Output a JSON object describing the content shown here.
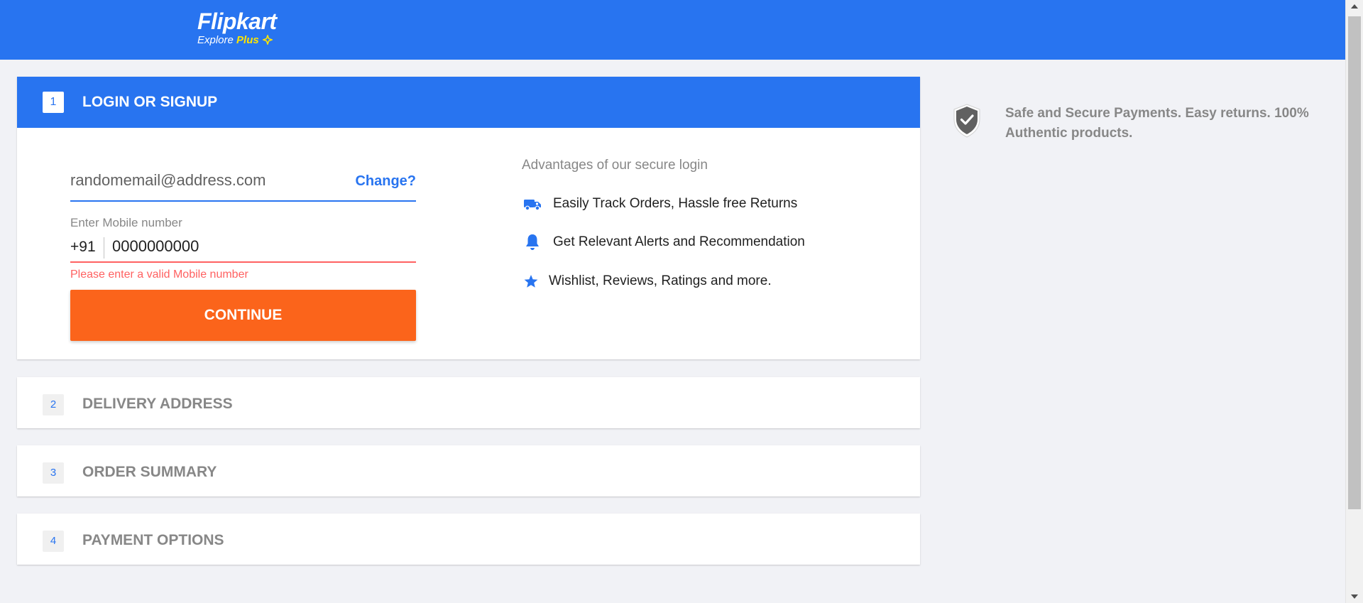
{
  "header": {
    "logo_main": "Flipkart",
    "logo_explore": "Explore",
    "logo_plus": "Plus",
    "brand_color": "#2874f0",
    "plus_color": "#ffe500"
  },
  "login": {
    "step_number": "1",
    "title": "LOGIN OR SIGNUP",
    "email_value": "randomemail@address.com",
    "change_label": "Change?",
    "mobile_label": "Enter Mobile number",
    "mobile_prefix": "+91",
    "mobile_value": "0000000000",
    "error_text": "Please enter a valid Mobile number",
    "continue_label": "CONTINUE",
    "button_color": "#fb641b",
    "error_color": "#ff6161"
  },
  "advantages": {
    "title": "Advantages of our secure login",
    "items": [
      {
        "icon": "truck-icon",
        "label": "Easily Track Orders, Hassle free Returns"
      },
      {
        "icon": "bell-icon",
        "label": "Get Relevant Alerts and Recommendation"
      },
      {
        "icon": "star-icon",
        "label": "Wishlist, Reviews, Ratings and more."
      }
    ]
  },
  "steps": [
    {
      "number": "2",
      "title": "DELIVERY ADDRESS"
    },
    {
      "number": "3",
      "title": "ORDER SUMMARY"
    },
    {
      "number": "4",
      "title": "PAYMENT OPTIONS"
    }
  ],
  "secure": {
    "icon": "shield-check-icon",
    "text": "Safe and Secure Payments. Easy returns. 100% Authentic products."
  }
}
